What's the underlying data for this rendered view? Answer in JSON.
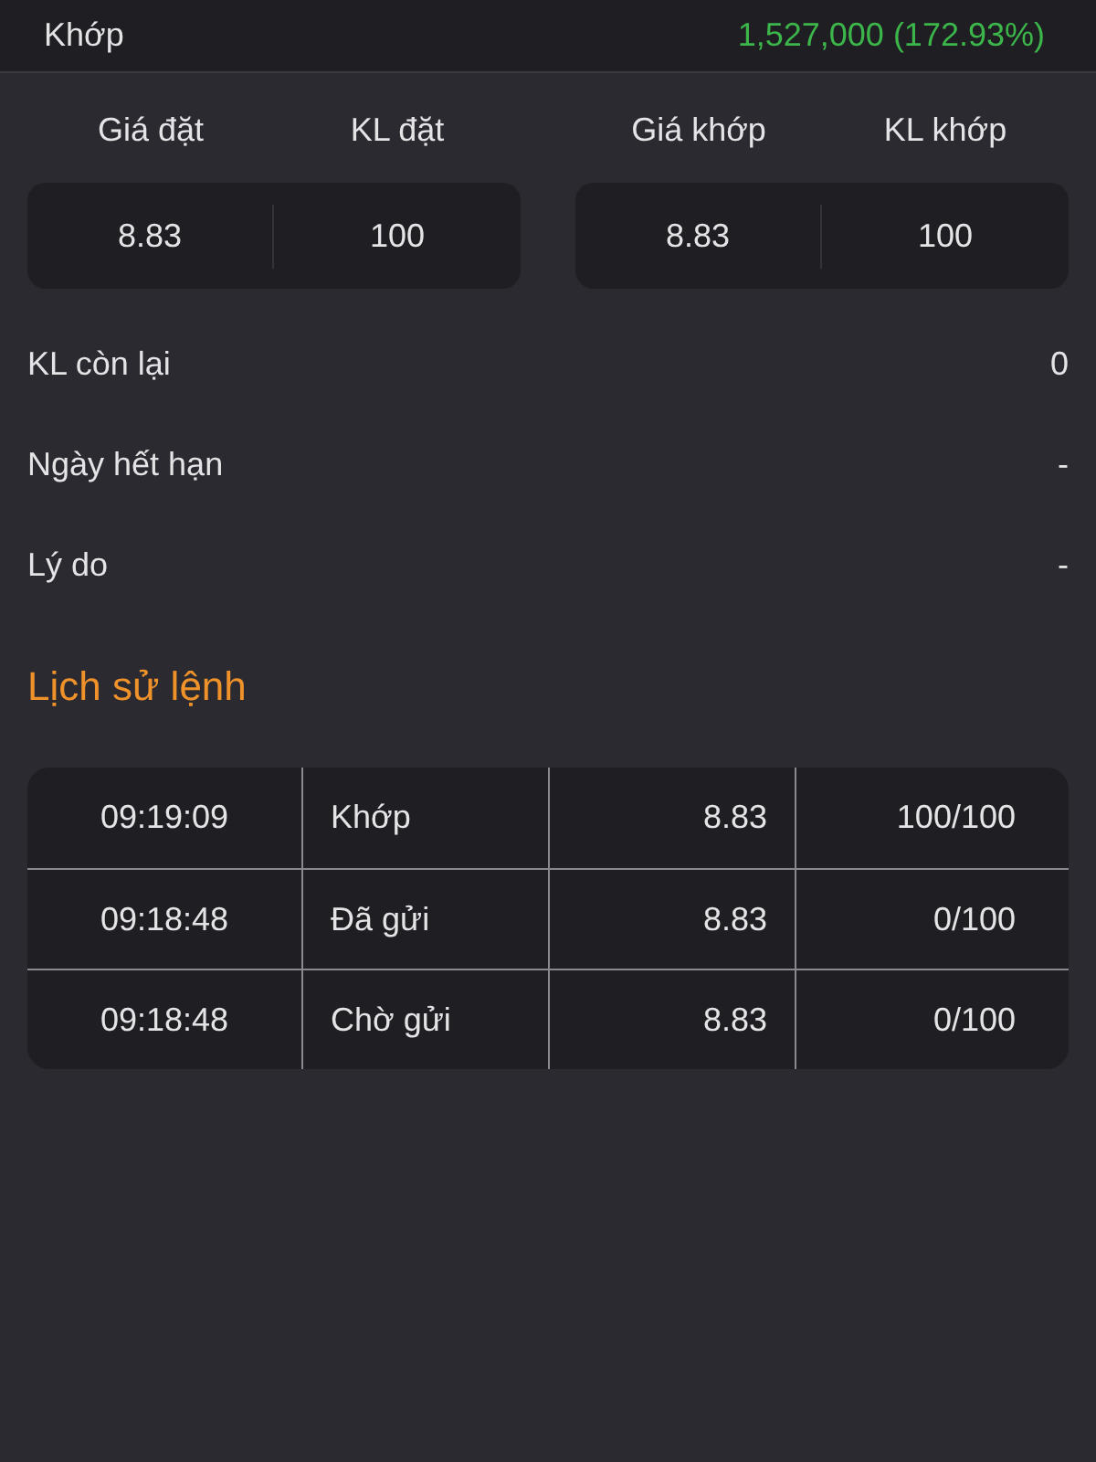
{
  "status_row": {
    "label": "Khớp",
    "value": "1,527,000 (172.93%)"
  },
  "order_box": {
    "columns": [
      "Giá đặt",
      "KL đặt"
    ],
    "values": [
      "8.83",
      "100"
    ]
  },
  "match_box": {
    "columns": [
      "Giá khớp",
      "KL khớp"
    ],
    "values": [
      "8.83",
      "100"
    ]
  },
  "details": [
    {
      "label": "KL còn lại",
      "value": "0"
    },
    {
      "label": "Ngày hết hạn",
      "value": "-"
    },
    {
      "label": "Lý do",
      "value": "-"
    }
  ],
  "history_title": "Lịch sử lệnh",
  "history_rows": [
    {
      "time": "09:19:09",
      "status": "Khớp",
      "price": "8.83",
      "volume": "100/100"
    },
    {
      "time": "09:18:48",
      "status": "Đã gửi",
      "price": "8.83",
      "volume": "0/100"
    },
    {
      "time": "09:18:48",
      "status": "Chờ gửi",
      "price": "8.83",
      "volume": "0/100"
    }
  ]
}
